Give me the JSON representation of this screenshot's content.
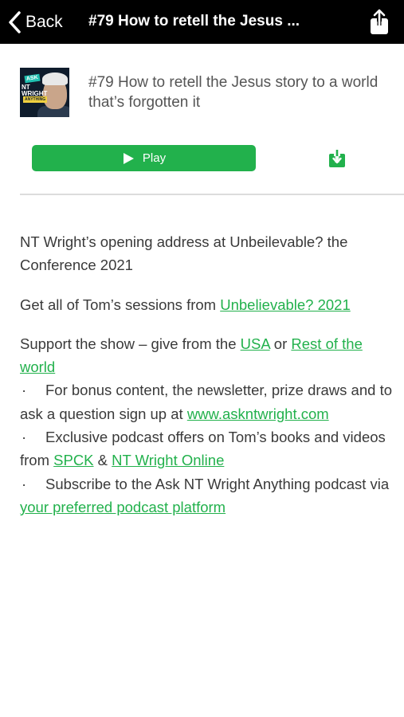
{
  "header": {
    "back_label": "Back",
    "title": "#79 How to retell the Jesus ..."
  },
  "episode": {
    "art": {
      "ask": "ASK",
      "nt_wright": "NT WRIGHT",
      "anything": "ANYTHING"
    },
    "title": "#79 How to retell the Jesus story to a world that’s forgotten it",
    "play_label": "Play"
  },
  "description": {
    "intro": "NT Wright’s opening address at Unbeilevable? the Conference 2021",
    "sessions_text": "Get all of Tom’s sessions from ",
    "sessions_link": "Unbelievable? 2021",
    "support_text": "Support the show – give from the ",
    "support_link_usa": "USA",
    "support_or": " or ",
    "support_link_rest": "Rest of the world",
    "bullet": "·",
    "bonus_text": "For bonus content, the newsletter, prize draws and to ask a question sign up at ",
    "bonus_link": "www.askntwright.com",
    "offers_text": "Exclusive podcast offers on Tom’s books and videos from ",
    "offers_link_spck": "SPCK",
    "offers_amp": " & ",
    "offers_link_online": "NT Wright Online",
    "subscribe_text": "Subscribe to the Ask NT Wright Anything podcast via ",
    "subscribe_link": "your preferred podcast platform"
  },
  "colors": {
    "accent": "#22b14c",
    "header_bg": "#000000"
  },
  "icons": {
    "back": "chevron-left-icon",
    "share": "share-icon",
    "play": "play-icon",
    "download": "download-icon"
  }
}
